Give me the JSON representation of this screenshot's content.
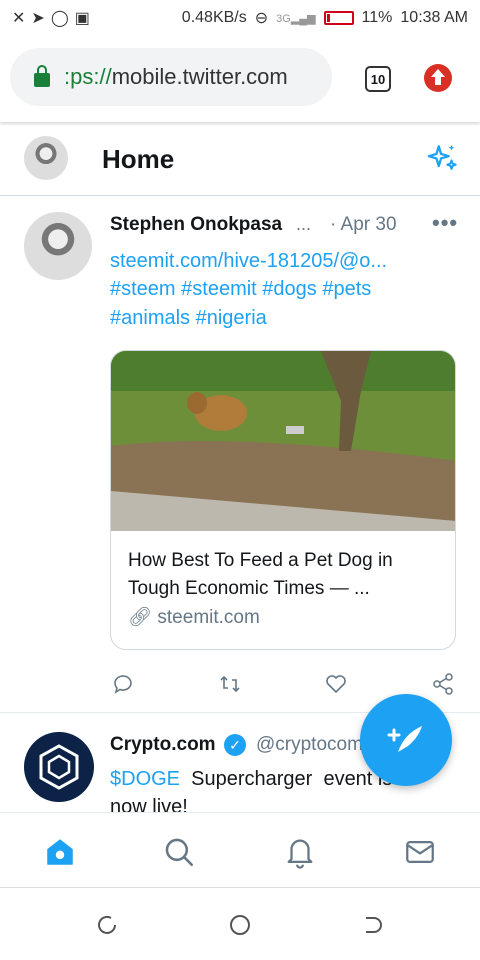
{
  "status": {
    "speed": "0.48KB/s",
    "network": "3G",
    "battery": "11%",
    "time": "10:38 AM"
  },
  "browser": {
    "url_scheme": ":ps://",
    "url_host": "mobile.twitter.com",
    "tab_count": "10"
  },
  "header": {
    "title": "Home"
  },
  "tweets": [
    {
      "author": "Stephen Onokpasa",
      "ellipsis": "...",
      "date": "· Apr 30",
      "more": "•••",
      "lines": [
        "steemit.com/hive-181205/@o...",
        "#steem #steemit #dogs #pets",
        "#animals #nigeria"
      ],
      "card": {
        "title": "How Best To Feed a Pet Dog in Tough Economic Times — ...",
        "domain": "steemit.com"
      }
    },
    {
      "author": "Crypto.com",
      "handle": "@cryptocom",
      "line1_tag": "$DOGE",
      "line1_rest": "  Supercharger  event is",
      "line2": "now live!"
    }
  ],
  "colors": {
    "accent": "#1da1f2",
    "secure": "#188038",
    "battery_low": "#d0021b"
  }
}
